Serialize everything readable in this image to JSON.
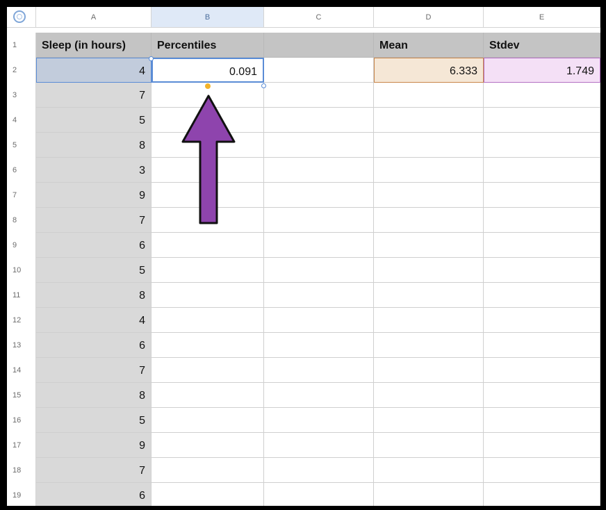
{
  "columns": [
    "A",
    "B",
    "C",
    "D",
    "E"
  ],
  "rows": [
    "1",
    "2",
    "3",
    "4",
    "5",
    "6",
    "7",
    "8",
    "9",
    "10",
    "11",
    "12",
    "13",
    "14",
    "15",
    "16",
    "17",
    "18",
    "19"
  ],
  "headers": {
    "a1": "Sleep (in hours)",
    "b1": "Percentiles",
    "c1": "",
    "d1": "Mean",
    "e1": "Stdev"
  },
  "sleep_hours": [
    "4",
    "7",
    "5",
    "8",
    "3",
    "9",
    "7",
    "6",
    "5",
    "8",
    "4",
    "6",
    "7",
    "8",
    "5",
    "9",
    "7",
    "6"
  ],
  "b2_value": "0.091",
  "mean_value": "6.333",
  "stdev_value": "1.749",
  "colors": {
    "arrow_fill": "#8e44ad",
    "selection_blue": "#5a8cd6",
    "mean_fill": "#f5e7d6",
    "stdev_fill": "#f4e0f6"
  }
}
